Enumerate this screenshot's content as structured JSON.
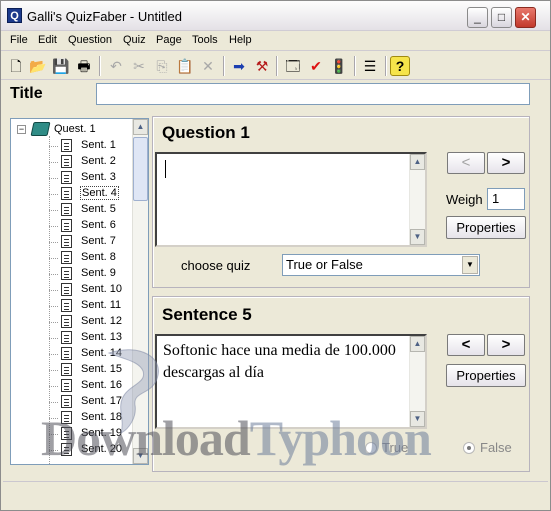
{
  "window": {
    "title": "Galli's QuizFaber - Untitled",
    "app_icon_letter": "Q",
    "controls": {
      "minimize": "_",
      "maximize": "□",
      "close": "✕"
    }
  },
  "menu": [
    "File",
    "Edit",
    "Question",
    "Quiz",
    "Page",
    "Tools",
    "Help"
  ],
  "toolbar": [
    {
      "name": "new-document-icon",
      "glyph": "🗋",
      "enabled": true
    },
    {
      "name": "open-folder-icon",
      "glyph": "📂",
      "enabled": true
    },
    {
      "name": "save-icon",
      "glyph": "💾",
      "enabled": true
    },
    {
      "name": "print-icon",
      "glyph": "🖶",
      "enabled": true
    },
    {
      "name": "undo-icon",
      "glyph": "↶",
      "enabled": false
    },
    {
      "name": "cut-icon",
      "glyph": "✂",
      "enabled": false
    },
    {
      "name": "copy-icon",
      "glyph": "⎘",
      "enabled": false
    },
    {
      "name": "paste-icon",
      "glyph": "📋",
      "enabled": true
    },
    {
      "name": "delete-icon",
      "glyph": "✕",
      "enabled": false
    },
    {
      "name": "forward-arrow-icon",
      "glyph": "➡",
      "enabled": true
    },
    {
      "name": "hammer-icon",
      "glyph": "⚒",
      "enabled": true
    },
    {
      "name": "properties-icon",
      "glyph": "🗔",
      "enabled": true
    },
    {
      "name": "check-icon",
      "glyph": "✔",
      "enabled": true
    },
    {
      "name": "traffic-light-icon",
      "glyph": "🚦",
      "enabled": true
    },
    {
      "name": "list-icon",
      "glyph": "☰",
      "enabled": true
    },
    {
      "name": "help-icon",
      "glyph": "?",
      "enabled": true
    }
  ],
  "title_field": {
    "label": "Title",
    "value": ""
  },
  "tree": {
    "root": "Quest. 1",
    "items": [
      "Sent. 1",
      "Sent. 2",
      "Sent. 3",
      "Sent. 4",
      "Sent. 5",
      "Sent. 6",
      "Sent. 7",
      "Sent. 8",
      "Sent. 9",
      "Sent. 10",
      "Sent. 11",
      "Sent. 12",
      "Sent. 13",
      "Sent. 14",
      "Sent. 15",
      "Sent. 16",
      "Sent. 17",
      "Sent. 18",
      "Sent. 19",
      "Sent. 20"
    ],
    "selected": "Sent. 4"
  },
  "question": {
    "heading": "Question 1",
    "text": "",
    "prev": "<",
    "next": ">",
    "weigh_label": "Weigh",
    "weigh_value": "1",
    "properties": "Properties",
    "choose_label": "choose quiz",
    "quiz_type": "True or False"
  },
  "sentence": {
    "heading": "Sentence 5",
    "text": "Softonic hace una media de 100.000 descargas al día",
    "prev": "<",
    "next": ">",
    "properties": "Properties",
    "true_label": "True",
    "false_label": "False",
    "selected": "False"
  },
  "watermark": {
    "text_a": "Download",
    "text_b": "Typhoon"
  }
}
